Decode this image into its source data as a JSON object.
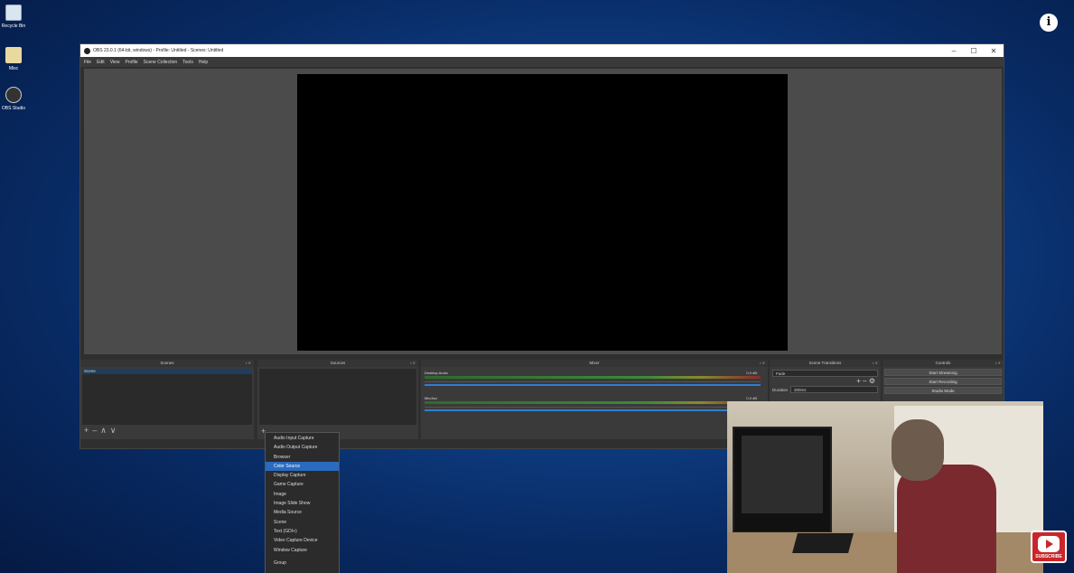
{
  "desktop": {
    "icons": [
      {
        "label": "Recycle Bin"
      },
      {
        "label": "Misc"
      },
      {
        "label": "OBS Studio"
      }
    ]
  },
  "window": {
    "title": "OBS 23.0.1 (64-bit, windows) - Profile: Untitled - Scenes: Untitled",
    "controls": {
      "minimize": "–",
      "maximize": "☐",
      "close": "✕"
    }
  },
  "menu": [
    "File",
    "Edit",
    "View",
    "Profile",
    "Scene Collection",
    "Tools",
    "Help"
  ],
  "docks": {
    "scenes": {
      "title": "Scenes",
      "items": [
        "Scene"
      ],
      "footer": [
        "+",
        "–",
        "∧",
        "∨"
      ]
    },
    "sources": {
      "title": "Sources",
      "footer": [
        "+"
      ]
    },
    "mixer": {
      "title": "Mixer",
      "tracks": [
        {
          "name": "Desktop Audio",
          "db": "0.0 dB"
        },
        {
          "name": "Mic/Aux",
          "db": "0.0 dB"
        }
      ]
    },
    "transitions": {
      "title": "Scene Transitions",
      "selected": "Fade",
      "duration_label": "Duration",
      "duration_value": "300ms"
    },
    "controls": {
      "title": "Controls",
      "buttons": [
        "Start Streaming",
        "Start Recording",
        "Studio Mode"
      ]
    }
  },
  "context_menu": {
    "items": [
      "Audio Input Capture",
      "Audio Output Capture",
      "Browser",
      "Color Source",
      "Display Capture",
      "Game Capture",
      "Image",
      "Image Slide Show",
      "Media Source",
      "Scene",
      "Text (GDI+)",
      "Video Capture Device",
      "Window Capture"
    ],
    "highlighted_index": 3,
    "group": "Group"
  },
  "overlay": {
    "subscribe_label": "SUBSCRIBE",
    "info": "i"
  }
}
